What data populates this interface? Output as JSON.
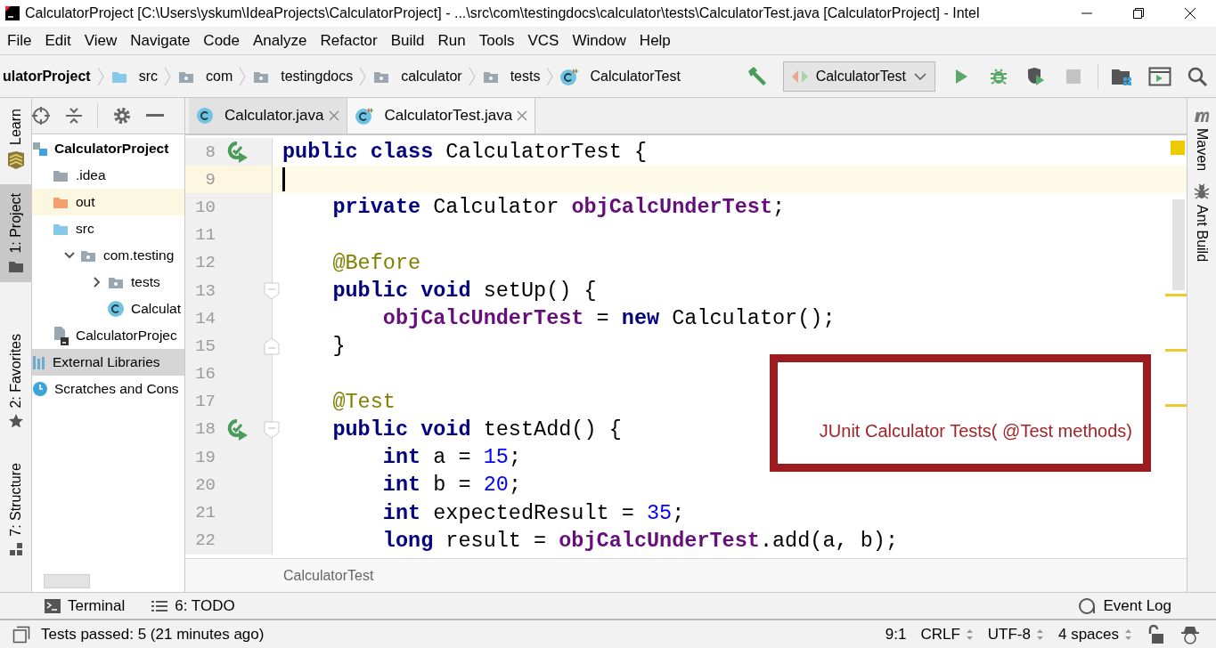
{
  "window": {
    "title": "CalculatorProject [C:\\Users\\yskum\\IdeaProjects\\CalculatorProject] - ...\\src\\com\\testingdocs\\calculator\\tests\\CalculatorTest.java [CalculatorProject] - Intel"
  },
  "menu": [
    "File",
    "Edit",
    "View",
    "Navigate",
    "Code",
    "Analyze",
    "Refactor",
    "Build",
    "Run",
    "Tools",
    "VCS",
    "Window",
    "Help"
  ],
  "breadcrumbs": [
    {
      "label": "ulatorProject",
      "kind": "project"
    },
    {
      "label": "src",
      "kind": "source-folder"
    },
    {
      "label": "com",
      "kind": "package"
    },
    {
      "label": "testingdocs",
      "kind": "package"
    },
    {
      "label": "calculator",
      "kind": "package"
    },
    {
      "label": "tests",
      "kind": "package"
    },
    {
      "label": "CalculatorTest",
      "kind": "test-class"
    }
  ],
  "run_config": {
    "label": "CalculatorTest"
  },
  "toolbar_buttons": [
    {
      "kind": "run",
      "disabled": false
    },
    {
      "kind": "debug",
      "disabled": false
    },
    {
      "kind": "coverage",
      "disabled": false
    },
    {
      "kind": "stop",
      "disabled": true
    }
  ],
  "left_stripe": [
    {
      "label": "Learn",
      "kind": "learn",
      "selected": false
    },
    {
      "label": "1: Project",
      "kind": "project",
      "selected": true
    },
    {
      "label": "2: Favorites",
      "kind": "favorites",
      "selected": false
    },
    {
      "label": "7: Structure",
      "kind": "structure",
      "selected": false
    }
  ],
  "project_tree": [
    {
      "label": "CalculatorProject",
      "kind": "module",
      "selected": false,
      "children": [
        {
          "label": ".idea",
          "kind": "folder",
          "selected": false
        },
        {
          "label": "out",
          "kind": "excluded-folder",
          "selected": false
        },
        {
          "label": "src",
          "kind": "source-folder",
          "selected": false,
          "children": [
            {
              "label": "com.testing",
              "kind": "package",
              "selected": false,
              "expanded": true,
              "children": [
                {
                  "label": "tests",
                  "kind": "package",
                  "selected": false,
                  "expanded": false
                },
                {
                  "label": "Calculat",
                  "kind": "class",
                  "selected": false
                }
              ]
            }
          ]
        },
        {
          "label": "CalculatorProjec",
          "kind": "iml",
          "selected": false
        }
      ]
    },
    {
      "label": "External Libraries",
      "kind": "library",
      "selected": true
    },
    {
      "label": "Scratches and Cons",
      "kind": "scratches",
      "selected": false
    }
  ],
  "editor_tabs": [
    {
      "label": "Calculator.java",
      "kind": "class",
      "selected": false
    },
    {
      "label": "CalculatorTest.java",
      "kind": "test-class",
      "selected": true
    }
  ],
  "code_lines": [
    {
      "number": "8",
      "current": false,
      "runnable": true,
      "tokens": [
        {
          "kind": "keyword",
          "text": "public class "
        },
        {
          "kind": "plain",
          "text": "CalculatorTest {"
        }
      ]
    },
    {
      "number": "9",
      "current": true
    },
    {
      "number": "10",
      "current": false,
      "tokens": [
        {
          "kind": "keyword",
          "text": "    private "
        },
        {
          "kind": "plain",
          "text": "Calculator "
        },
        {
          "kind": "field",
          "text": "objCalcUnderTest"
        },
        {
          "kind": "plain",
          "text": ";"
        }
      ]
    },
    {
      "number": "11",
      "current": false
    },
    {
      "number": "12",
      "current": false,
      "tokens": [
        {
          "kind": "annotation",
          "text": "    @Before"
        }
      ]
    },
    {
      "number": "13",
      "current": false,
      "fold_start": true,
      "tokens": [
        {
          "kind": "keyword",
          "text": "    public void "
        },
        {
          "kind": "plain",
          "text": "setUp() {"
        }
      ]
    },
    {
      "number": "14",
      "current": false,
      "tokens": [
        {
          "kind": "field",
          "text": "        objCalcUnderTest"
        },
        {
          "kind": "plain",
          "text": " = "
        },
        {
          "kind": "keyword",
          "text": "new "
        },
        {
          "kind": "plain",
          "text": "Calculator();"
        }
      ]
    },
    {
      "number": "15",
      "current": false,
      "fold_end": true,
      "tokens": [
        {
          "kind": "plain",
          "text": "    }"
        }
      ]
    },
    {
      "number": "16",
      "current": false
    },
    {
      "number": "17",
      "current": false,
      "tokens": [
        {
          "kind": "annotation",
          "text": "    @Test"
        }
      ]
    },
    {
      "number": "18",
      "current": false,
      "runnable": true,
      "fold_start": true,
      "tokens": [
        {
          "kind": "keyword",
          "text": "    public void "
        },
        {
          "kind": "plain",
          "text": "testAdd() {"
        }
      ]
    },
    {
      "number": "19",
      "current": false,
      "tokens": [
        {
          "kind": "keyword",
          "text": "        int "
        },
        {
          "kind": "plain",
          "text": "a = "
        },
        {
          "kind": "number",
          "text": "15"
        },
        {
          "kind": "plain",
          "text": ";"
        }
      ]
    },
    {
      "number": "20",
      "current": false,
      "tokens": [
        {
          "kind": "keyword",
          "text": "        int "
        },
        {
          "kind": "plain",
          "text": "b = "
        },
        {
          "kind": "number",
          "text": "20"
        },
        {
          "kind": "plain",
          "text": ";"
        }
      ]
    },
    {
      "number": "21",
      "current": false,
      "tokens": [
        {
          "kind": "keyword",
          "text": "        int "
        },
        {
          "kind": "plain",
          "text": "expectedResult = "
        },
        {
          "kind": "number",
          "text": "35"
        },
        {
          "kind": "plain",
          "text": ";"
        }
      ]
    },
    {
      "number": "22",
      "current": false,
      "tokens": [
        {
          "kind": "keyword",
          "text": "        long "
        },
        {
          "kind": "plain",
          "text": "result = "
        },
        {
          "kind": "field",
          "text": "objCalcUnderTest"
        },
        {
          "kind": "plain",
          "text": ".add(a, b);"
        }
      ]
    }
  ],
  "annotation": {
    "text": "JUnit Calculator Tests( @Test methods)"
  },
  "editor_breadcrumb": "CalculatorTest",
  "right_stripe": [
    {
      "label": "Maven",
      "kind": "maven"
    },
    {
      "label": "Ant Build",
      "kind": "ant"
    }
  ],
  "bottom_tools": [
    {
      "label": "Terminal",
      "kind": "terminal"
    },
    {
      "label": "6: TODO",
      "kind": "todo"
    }
  ],
  "event_log": "Event Log",
  "status_bar": {
    "message": "Tests passed: 5 (21 minutes ago)",
    "position": "9:1",
    "line_separator": "CRLF",
    "encoding": "UTF-8",
    "indent": "4 spaces"
  }
}
